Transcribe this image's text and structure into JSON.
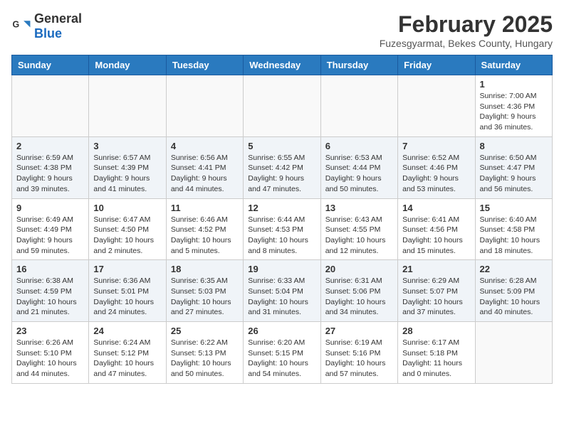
{
  "header": {
    "logo_general": "General",
    "logo_blue": "Blue",
    "month_title": "February 2025",
    "subtitle": "Fuzesgyarmat, Bekes County, Hungary"
  },
  "weekdays": [
    "Sunday",
    "Monday",
    "Tuesday",
    "Wednesday",
    "Thursday",
    "Friday",
    "Saturday"
  ],
  "weeks": [
    [
      {
        "day": "",
        "info": ""
      },
      {
        "day": "",
        "info": ""
      },
      {
        "day": "",
        "info": ""
      },
      {
        "day": "",
        "info": ""
      },
      {
        "day": "",
        "info": ""
      },
      {
        "day": "",
        "info": ""
      },
      {
        "day": "1",
        "info": "Sunrise: 7:00 AM\nSunset: 4:36 PM\nDaylight: 9 hours and 36 minutes."
      }
    ],
    [
      {
        "day": "2",
        "info": "Sunrise: 6:59 AM\nSunset: 4:38 PM\nDaylight: 9 hours and 39 minutes."
      },
      {
        "day": "3",
        "info": "Sunrise: 6:57 AM\nSunset: 4:39 PM\nDaylight: 9 hours and 41 minutes."
      },
      {
        "day": "4",
        "info": "Sunrise: 6:56 AM\nSunset: 4:41 PM\nDaylight: 9 hours and 44 minutes."
      },
      {
        "day": "5",
        "info": "Sunrise: 6:55 AM\nSunset: 4:42 PM\nDaylight: 9 hours and 47 minutes."
      },
      {
        "day": "6",
        "info": "Sunrise: 6:53 AM\nSunset: 4:44 PM\nDaylight: 9 hours and 50 minutes."
      },
      {
        "day": "7",
        "info": "Sunrise: 6:52 AM\nSunset: 4:46 PM\nDaylight: 9 hours and 53 minutes."
      },
      {
        "day": "8",
        "info": "Sunrise: 6:50 AM\nSunset: 4:47 PM\nDaylight: 9 hours and 56 minutes."
      }
    ],
    [
      {
        "day": "9",
        "info": "Sunrise: 6:49 AM\nSunset: 4:49 PM\nDaylight: 9 hours and 59 minutes."
      },
      {
        "day": "10",
        "info": "Sunrise: 6:47 AM\nSunset: 4:50 PM\nDaylight: 10 hours and 2 minutes."
      },
      {
        "day": "11",
        "info": "Sunrise: 6:46 AM\nSunset: 4:52 PM\nDaylight: 10 hours and 5 minutes."
      },
      {
        "day": "12",
        "info": "Sunrise: 6:44 AM\nSunset: 4:53 PM\nDaylight: 10 hours and 8 minutes."
      },
      {
        "day": "13",
        "info": "Sunrise: 6:43 AM\nSunset: 4:55 PM\nDaylight: 10 hours and 12 minutes."
      },
      {
        "day": "14",
        "info": "Sunrise: 6:41 AM\nSunset: 4:56 PM\nDaylight: 10 hours and 15 minutes."
      },
      {
        "day": "15",
        "info": "Sunrise: 6:40 AM\nSunset: 4:58 PM\nDaylight: 10 hours and 18 minutes."
      }
    ],
    [
      {
        "day": "16",
        "info": "Sunrise: 6:38 AM\nSunset: 4:59 PM\nDaylight: 10 hours and 21 minutes."
      },
      {
        "day": "17",
        "info": "Sunrise: 6:36 AM\nSunset: 5:01 PM\nDaylight: 10 hours and 24 minutes."
      },
      {
        "day": "18",
        "info": "Sunrise: 6:35 AM\nSunset: 5:03 PM\nDaylight: 10 hours and 27 minutes."
      },
      {
        "day": "19",
        "info": "Sunrise: 6:33 AM\nSunset: 5:04 PM\nDaylight: 10 hours and 31 minutes."
      },
      {
        "day": "20",
        "info": "Sunrise: 6:31 AM\nSunset: 5:06 PM\nDaylight: 10 hours and 34 minutes."
      },
      {
        "day": "21",
        "info": "Sunrise: 6:29 AM\nSunset: 5:07 PM\nDaylight: 10 hours and 37 minutes."
      },
      {
        "day": "22",
        "info": "Sunrise: 6:28 AM\nSunset: 5:09 PM\nDaylight: 10 hours and 40 minutes."
      }
    ],
    [
      {
        "day": "23",
        "info": "Sunrise: 6:26 AM\nSunset: 5:10 PM\nDaylight: 10 hours and 44 minutes."
      },
      {
        "day": "24",
        "info": "Sunrise: 6:24 AM\nSunset: 5:12 PM\nDaylight: 10 hours and 47 minutes."
      },
      {
        "day": "25",
        "info": "Sunrise: 6:22 AM\nSunset: 5:13 PM\nDaylight: 10 hours and 50 minutes."
      },
      {
        "day": "26",
        "info": "Sunrise: 6:20 AM\nSunset: 5:15 PM\nDaylight: 10 hours and 54 minutes."
      },
      {
        "day": "27",
        "info": "Sunrise: 6:19 AM\nSunset: 5:16 PM\nDaylight: 10 hours and 57 minutes."
      },
      {
        "day": "28",
        "info": "Sunrise: 6:17 AM\nSunset: 5:18 PM\nDaylight: 11 hours and 0 minutes."
      },
      {
        "day": "",
        "info": ""
      }
    ]
  ]
}
